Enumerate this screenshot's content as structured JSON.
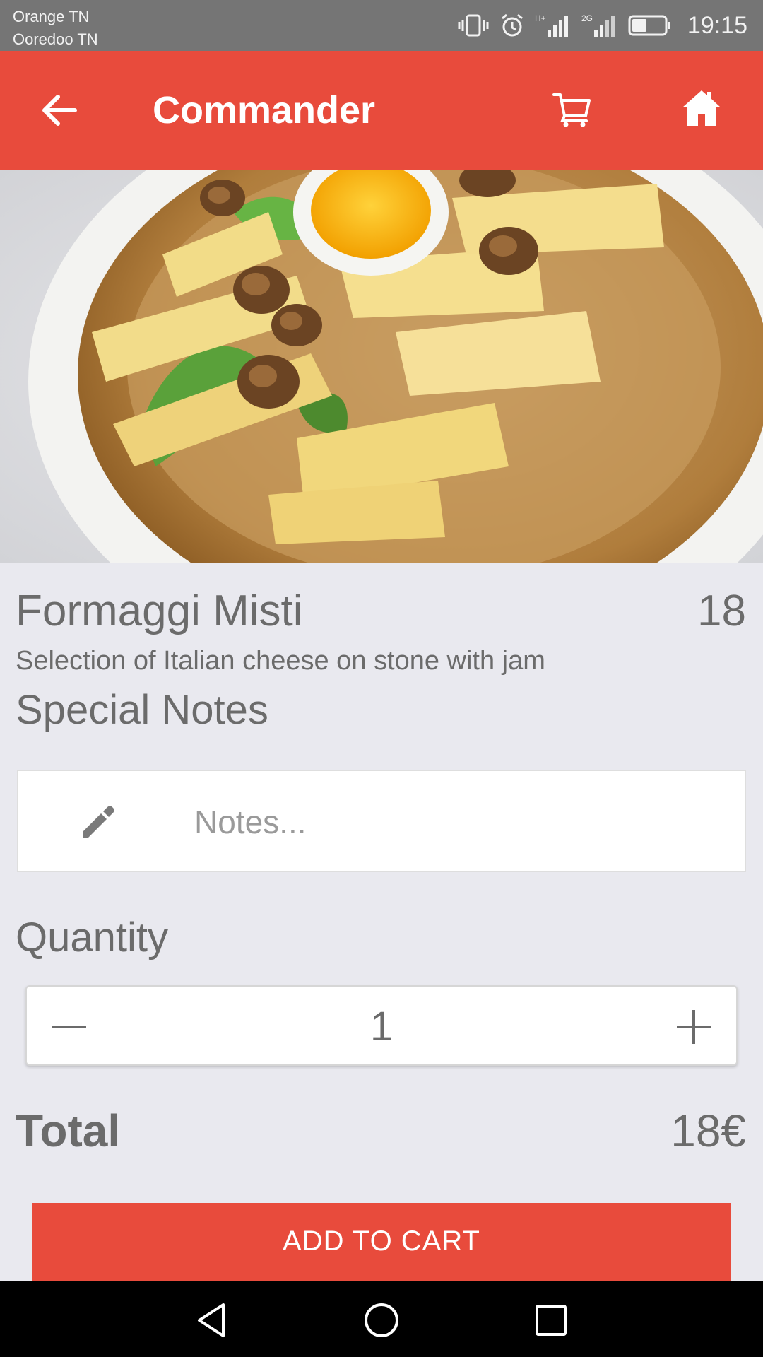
{
  "status_bar": {
    "carrier_1": "Orange TN",
    "carrier_2": "Ooredoo TN",
    "network_1": "H+",
    "network_2": "2G",
    "battery_level": 0.45,
    "time": "19:15"
  },
  "app_bar": {
    "title": "Commander",
    "back_icon": "arrow-left-icon",
    "cart_icon": "cart-icon",
    "home_icon": "home-icon",
    "color": "#e84b3c"
  },
  "dish": {
    "name": "Formaggi Misti",
    "price": "18",
    "description": "Selection of Italian cheese on stone with jam"
  },
  "notes": {
    "heading": "Special Notes",
    "placeholder": "Notes...",
    "value": "",
    "icon": "pencil-icon"
  },
  "quantity": {
    "heading": "Quantity",
    "value": "1",
    "decrement_icon": "minus-icon",
    "increment_icon": "plus-icon"
  },
  "total": {
    "label": "Total",
    "value": "18€"
  },
  "add_to_cart": {
    "label": "ADD TO CART"
  },
  "nav_bar": {
    "back_icon": "triangle-back-icon",
    "home_icon": "circle-home-icon",
    "recent_icon": "square-recent-icon"
  }
}
